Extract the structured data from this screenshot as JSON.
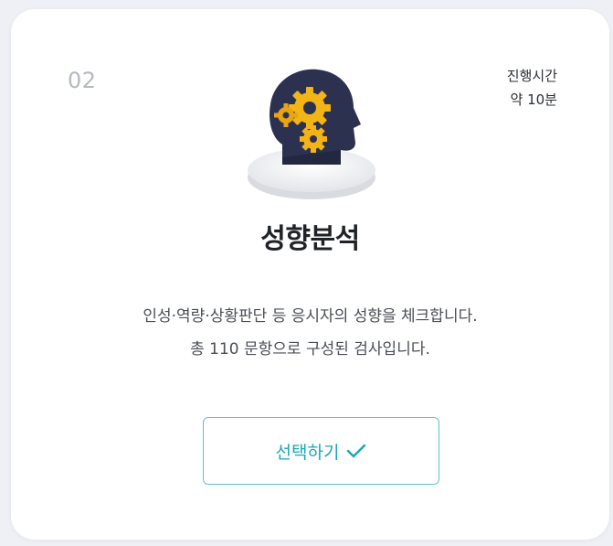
{
  "card": {
    "step_number": "02",
    "duration_label": "진행시간",
    "duration_value": "약 10분",
    "illustration_icon": "head-gears-icon",
    "title": "성향분석",
    "description_line1": "인성·역량·상황판단 등 응시자의 성향을 체크합니다.",
    "description_line2": "총 110 문항으로 구성된 검사입니다.",
    "select_button_label": "선택하기",
    "select_button_icon": "check-icon"
  },
  "colors": {
    "accent": "#1aa7b6",
    "button_border": "#5ec4cd",
    "gear": "#f3b417",
    "head": "#2c3150",
    "background": "#eef0f5"
  }
}
